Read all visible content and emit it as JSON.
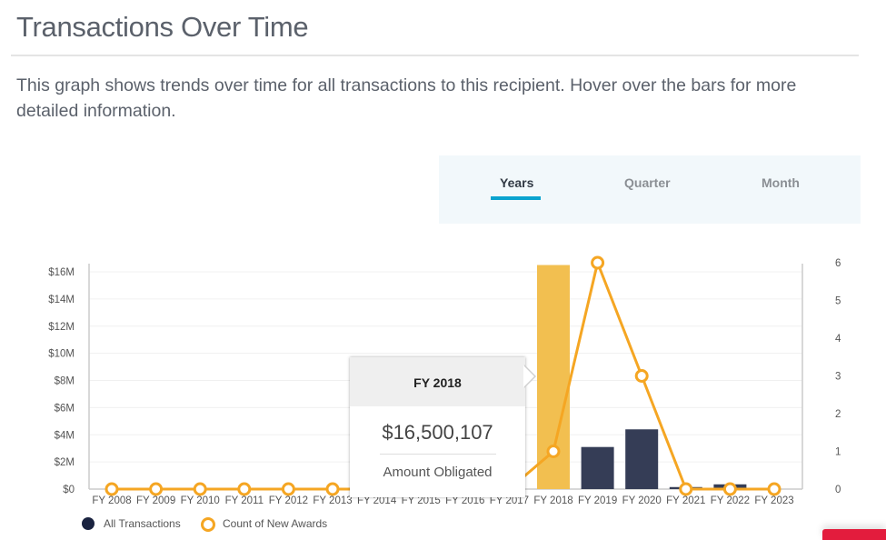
{
  "header": {
    "title": "Transactions Over Time",
    "description": "This graph shows trends over time for all transactions to this recipient. Hover over the bars for more detailed information."
  },
  "period_tabs": [
    {
      "label": "Years",
      "active": true
    },
    {
      "label": "Quarter",
      "active": false
    },
    {
      "label": "Month",
      "active": false
    }
  ],
  "colors": {
    "bar": "#353d56",
    "bar_highlight": "#f2bf50",
    "line": "#f5a623",
    "tab_accent": "#0aa3cf",
    "legend_bar": "#1a2340"
  },
  "tooltip": {
    "title": "FY 2018",
    "value": "$16,500,107",
    "label": "Amount Obligated"
  },
  "legend": [
    {
      "label": "All Transactions",
      "icon": "filled-circle"
    },
    {
      "label": "Count of New Awards",
      "icon": "ring-circle"
    }
  ],
  "chart_data": {
    "type": "bar",
    "title": "Transactions Over Time",
    "categories": [
      "FY 2008",
      "FY 2009",
      "FY 2010",
      "FY 2011",
      "FY 2012",
      "FY 2013",
      "FY 2014",
      "FY 2015",
      "FY 2016",
      "FY 2017",
      "FY 2018",
      "FY 2019",
      "FY 2020",
      "FY 2021",
      "FY 2022",
      "FY 2023"
    ],
    "highlighted_category": "FY 2018",
    "series": [
      {
        "name": "All Transactions",
        "type": "bar",
        "axis": "left",
        "values": [
          0,
          0,
          0,
          0,
          0,
          0,
          0,
          0,
          0,
          0,
          16500107,
          3100000,
          4400000,
          150000,
          350000,
          0
        ]
      },
      {
        "name": "Count of New Awards",
        "type": "line",
        "axis": "right",
        "values": [
          0,
          0,
          0,
          0,
          0,
          0,
          0,
          0,
          0,
          0,
          1,
          6,
          3,
          0,
          0,
          0
        ]
      }
    ],
    "y_left": {
      "ticks": [
        "$0",
        "$2M",
        "$4M",
        "$6M",
        "$8M",
        "$10M",
        "$12M",
        "$14M",
        "$16M"
      ],
      "range": [
        0,
        16000000
      ],
      "step": 2000000
    },
    "y_right": {
      "ticks": [
        "0",
        "1",
        "2",
        "3",
        "4",
        "5",
        "6"
      ],
      "range": [
        0,
        6
      ]
    },
    "grid": true,
    "legend_position": "bottom-left"
  }
}
